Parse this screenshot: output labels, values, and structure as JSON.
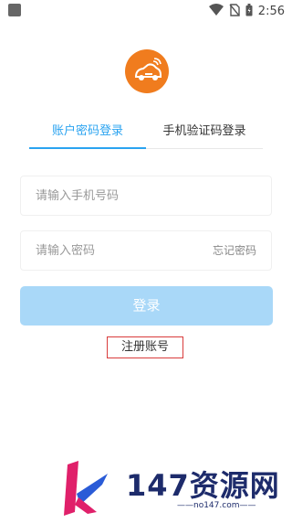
{
  "status_bar": {
    "time": "2:56"
  },
  "tabs": [
    {
      "label": "账户密码登录",
      "active": true
    },
    {
      "label": "手机验证码登录",
      "active": false
    }
  ],
  "phone_field": {
    "placeholder": "请输入手机号码",
    "value": ""
  },
  "password_field": {
    "placeholder": "请输入密码",
    "value": ""
  },
  "forgot_password": "忘记密码",
  "login_button": "登录",
  "register_link": "注册账号",
  "watermark": {
    "text": "147资源网",
    "site": "——no147.com——"
  },
  "colors": {
    "accent": "#2aa3f0",
    "logo_bg": "#f07c1e",
    "button_bg": "#a9d8f8",
    "highlight_border": "#d93b3b"
  }
}
